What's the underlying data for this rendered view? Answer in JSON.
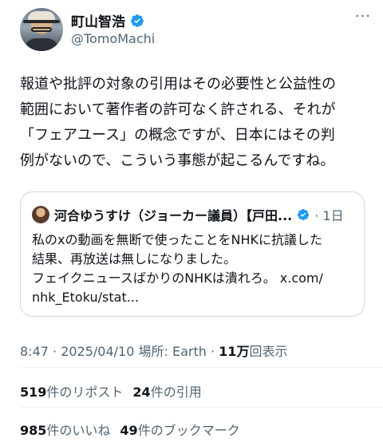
{
  "author": {
    "display_name": "町山智浩",
    "handle": "@TomoMachi",
    "more_label": "···"
  },
  "tweet": {
    "lines": [
      "報道や批評の対象の引用はその必要性と公益性の",
      "範囲において著作者の許可なく許される、それが",
      "「フェアユース」の概念ですが、日本にはその判",
      "例がないので、こういう事態が起こるんですね。"
    ]
  },
  "quote": {
    "name": "河合ゆうすけ（ジョーカー議員）【戸田...",
    "time": "· 1日",
    "lines": [
      "私のxの動画を無断で使ったことをNHKに抗議した",
      "結果、再放送は無しになりました。",
      "フェイクニュースばかりのNHKは潰れろ。 x.com/",
      "nhk_Etoku/stat..."
    ]
  },
  "meta": {
    "time_date": "8:47 · 2025/04/10",
    "location_label": "場所: Earth",
    "sep": "·",
    "views_count": "11万",
    "views_label": "回表示"
  },
  "stats": {
    "reposts_count": "519",
    "reposts_label": "件のリポスト",
    "quotes_count": "24",
    "quotes_label": "件の引用",
    "likes_count": "985",
    "likes_label": "件のいいね",
    "bookmarks_count": "49",
    "bookmarks_label": "件のブックマーク"
  },
  "colors": {
    "verified_blue": "#1d9bf0",
    "secondary_text": "#536471"
  }
}
